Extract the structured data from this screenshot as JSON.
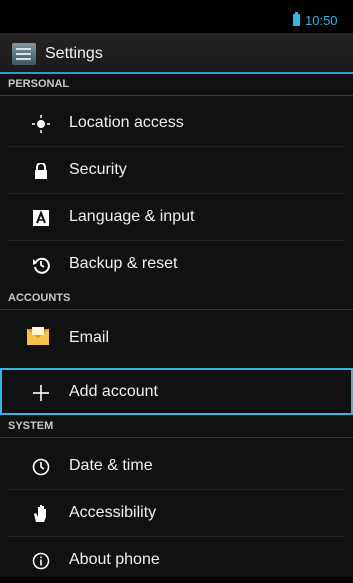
{
  "status_bar": {
    "time": "10:50",
    "battery_icon": "battery-icon"
  },
  "action_bar": {
    "title": "Settings",
    "icon": "settings-app-icon"
  },
  "sections": {
    "personal": "PERSONAL",
    "accounts": "ACCOUNTS",
    "system": "SYSTEM"
  },
  "items": {
    "location": {
      "label": "Location access",
      "icon": "location-icon"
    },
    "security": {
      "label": "Security",
      "icon": "lock-icon"
    },
    "language": {
      "label": "Language & input",
      "icon": "keyboard-icon"
    },
    "backup": {
      "label": "Backup & reset",
      "icon": "backup-icon"
    },
    "email": {
      "label": "Email",
      "icon": "email-icon"
    },
    "add_account": {
      "label": "Add account",
      "icon": "plus-icon"
    },
    "date_time": {
      "label": "Date & time",
      "icon": "clock-icon"
    },
    "accessibility": {
      "label": "Accessibility",
      "icon": "hand-icon"
    },
    "about": {
      "label": "About phone",
      "icon": "info-icon"
    }
  },
  "colors": {
    "accent": "#33b5e5",
    "background": "#111111"
  }
}
